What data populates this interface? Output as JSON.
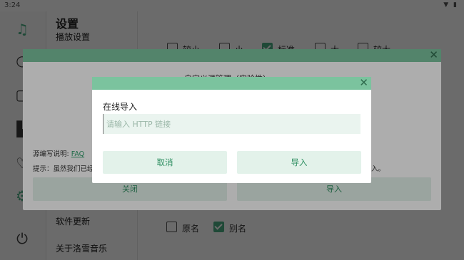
{
  "status_bar": {
    "time": "3:24"
  },
  "page": {
    "title": "设置",
    "categories": [
      "播放设置",
      "软件更新",
      "关于洛雪音乐"
    ]
  },
  "quality_options": [
    {
      "label": "较小",
      "checked": false
    },
    {
      "label": "小",
      "checked": false
    },
    {
      "label": "标准",
      "checked": true
    },
    {
      "label": "大",
      "checked": false
    },
    {
      "label": "较大",
      "checked": false
    }
  ],
  "name_options": [
    {
      "label": "原名",
      "checked": false
    },
    {
      "label": "别名",
      "checked": true
    }
  ],
  "source_dialog": {
    "title": "自定义源管理（实验性）",
    "note_label": "源编写说明:",
    "note_link": "FAQ",
    "tip_prefix": "提示：虽然我们已经",
    "tip_suffix": "入。",
    "close_button": "关闭",
    "import_button": "导入"
  },
  "online_import_dialog": {
    "title": "在线导入",
    "input_placeholder": "请输入 HTTP 链接",
    "input_value": "",
    "cancel_button": "取消",
    "import_button": "导入"
  },
  "colors": {
    "accent": "#4caf84",
    "dialog_header": "#7bc39e",
    "button_bg": "#e3f2ea",
    "button_text": "#2f8f62"
  }
}
